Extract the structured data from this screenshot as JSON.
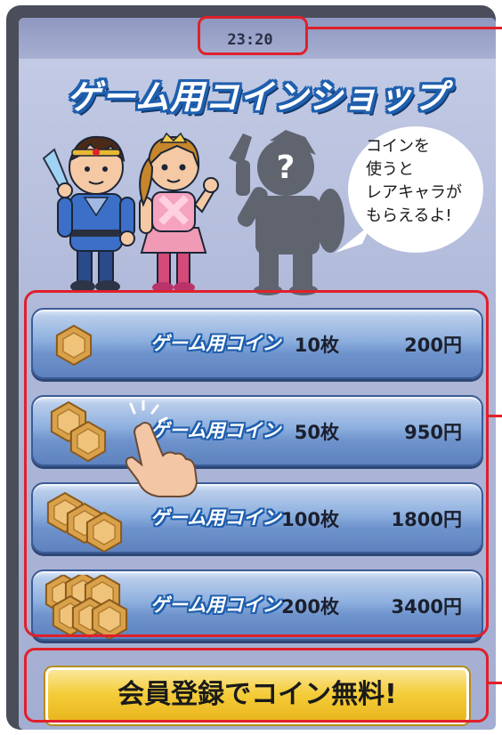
{
  "status_bar": {
    "time": "23:20"
  },
  "shop": {
    "title": "ゲーム用コインショップ"
  },
  "speech_bubble": {
    "lines": [
      "コインを",
      "使うと",
      "レアキャラが",
      "もらえるよ!"
    ]
  },
  "characters": {
    "hidden_mark": "?",
    "icons": [
      "hero-boy-icon",
      "hero-girl-icon",
      "mystery-character-icon"
    ]
  },
  "products": [
    {
      "name": "ゲーム用コイン",
      "quantity": "10枚",
      "price": "200円",
      "coin_count": 1
    },
    {
      "name": "ゲーム用コイン",
      "quantity": "50枚",
      "price": "950円",
      "coin_count": 2
    },
    {
      "name": "ゲーム用コイン",
      "quantity": "100枚",
      "price": "1800円",
      "coin_count": 3
    },
    {
      "name": "ゲーム用コイン",
      "quantity": "200枚",
      "price": "3400円",
      "coin_count": 6
    }
  ],
  "member_button": {
    "label": "会員登録でコイン無料!"
  },
  "colors": {
    "highlight": "#e0202a",
    "title_outline": "#1f5fae",
    "button_gold": "#f4cd3a",
    "product_blue": "#8eb0df",
    "coin_gold": "#d9a14a"
  }
}
